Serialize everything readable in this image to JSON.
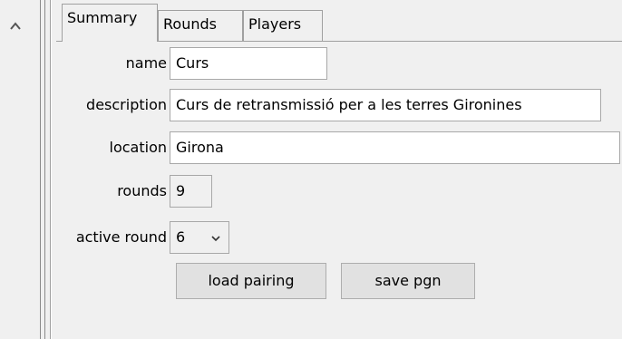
{
  "tabs": [
    {
      "label": "Summary",
      "active": true
    },
    {
      "label": "Rounds",
      "active": false
    },
    {
      "label": "Players",
      "active": false
    }
  ],
  "form": {
    "name": {
      "label": "name",
      "value": "Curs"
    },
    "description": {
      "label": "description",
      "value": "Curs de retransmissió per a les terres Gironines"
    },
    "location": {
      "label": "location",
      "value": "Girona"
    },
    "rounds": {
      "label": "rounds",
      "value": "9"
    },
    "active_round": {
      "label": "active round",
      "value": "6"
    }
  },
  "buttons": {
    "load_pairing": "load pairing",
    "save_pgn": "save pgn"
  },
  "icons": {
    "scroll_up": "chevron-up-icon",
    "combo_arrow": "chevron-down-icon"
  }
}
